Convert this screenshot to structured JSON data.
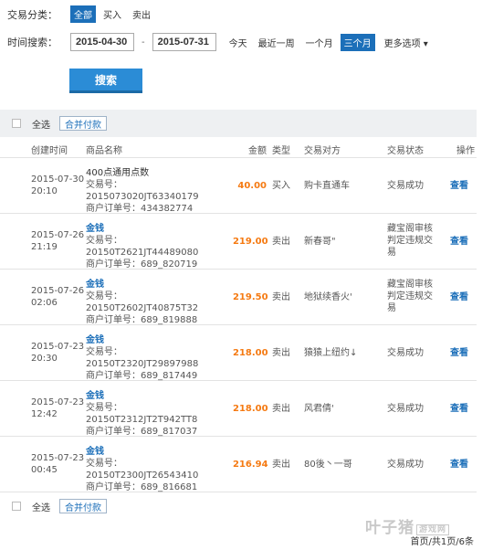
{
  "filter": {
    "category_label": "交易分类：",
    "category_options": [
      "全部",
      "买入",
      "卖出"
    ],
    "time_label": "时间搜索：",
    "date_from": "2015-04-30",
    "date_to": "2015-07-31",
    "date_sep": "-",
    "quick_ranges": [
      "今天",
      "最近一周",
      "一个月",
      "三个月"
    ],
    "more_options": "更多选项 ▾",
    "search_label": "搜索"
  },
  "bulk": {
    "select_all": "全选",
    "merge_pay": "合并付款"
  },
  "table": {
    "headers": [
      "创建时间",
      "商品名称",
      "金额",
      "类型",
      "交易对方",
      "交易状态",
      "操作"
    ],
    "rows": [
      {
        "date": "2015-07-30",
        "time": "20:10",
        "title": "400点通用点数",
        "txn": "交易号：2015073020JT63340179",
        "order": "商户订单号：434382774",
        "amount": "40.00",
        "type": "买入",
        "party": "购卡直通车",
        "status": [
          "交易成功"
        ],
        "op": "查看"
      },
      {
        "date": "2015-07-26",
        "time": "21:19",
        "title": "金钱",
        "txn": "交易号：20150T2621JT44489080",
        "order": "商户订单号：689_820719",
        "amount": "219.00",
        "type": "卖出",
        "party": "新春哥\"",
        "status": [
          "藏宝阁审核",
          "判定违规交",
          "易"
        ],
        "op": "查看"
      },
      {
        "date": "2015-07-26",
        "time": "02:06",
        "title": "金钱",
        "txn": "交易号：20150T2602JT40875T32",
        "order": "商户订单号：689_819888",
        "amount": "219.50",
        "type": "卖出",
        "party": "地狱续香火'",
        "status": [
          "藏宝阁审核",
          "判定违规交",
          "易"
        ],
        "op": "查看"
      },
      {
        "date": "2015-07-23",
        "time": "20:30",
        "title": "金钱",
        "txn": "交易号：20150T2320JT29897988",
        "order": "商户订单号：689_817449",
        "amount": "218.00",
        "type": "卖出",
        "party": "猿猿上纽约↓",
        "status": [
          "交易成功"
        ],
        "op": "查看"
      },
      {
        "date": "2015-07-23",
        "time": "12:42",
        "title": "金钱",
        "txn": "交易号：20150T2312JT2T942TT8",
        "order": "商户订单号：689_817037",
        "amount": "218.00",
        "type": "卖出",
        "party": "风君倩'",
        "status": [
          "交易成功"
        ],
        "op": "查看"
      },
      {
        "date": "2015-07-23",
        "time": "00:45",
        "title": "金钱",
        "txn": "交易号：20150T2300JT26543410",
        "order": "商户订单号：689_816681",
        "amount": "216.94",
        "type": "卖出",
        "party": "80後丶一哥",
        "status": [
          "交易成功"
        ],
        "op": "查看"
      }
    ]
  },
  "pager": "首页/共1页/6条",
  "watermark": {
    "text": "叶子猪",
    "tag": "游戏网"
  }
}
